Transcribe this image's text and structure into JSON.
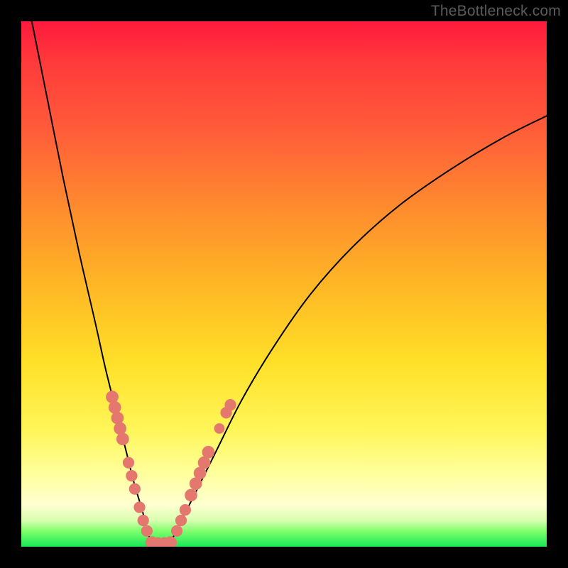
{
  "watermark": "TheBottleneck.com",
  "chart_data": {
    "type": "line",
    "title": "",
    "xlabel": "",
    "ylabel": "",
    "xlim": [
      0,
      100
    ],
    "ylim": [
      0,
      100
    ],
    "grid": false,
    "legend": false,
    "background_gradient": [
      "#ff1a3c",
      "#ff8a2e",
      "#ffe028",
      "#ffff9c",
      "#18e858"
    ],
    "series": [
      {
        "name": "left-branch",
        "x": [
          2,
          5,
          8,
          11,
          14,
          16,
          18,
          20,
          21.5,
          23,
          24,
          25
        ],
        "y": [
          100,
          85,
          70,
          56,
          43,
          34,
          26,
          18,
          12,
          7,
          3,
          0
        ]
      },
      {
        "name": "right-branch",
        "x": [
          28,
          30,
          33,
          37,
          42,
          48,
          55,
          63,
          72,
          82,
          92,
          100
        ],
        "y": [
          0,
          4,
          10,
          18,
          28,
          38,
          48,
          57,
          65,
          72,
          78,
          82
        ]
      }
    ],
    "marker_clusters": [
      {
        "name": "left-cluster-upper",
        "color": "#e4786f",
        "points": [
          {
            "x": 17.3,
            "y": 28.5,
            "r": 1.2
          },
          {
            "x": 17.8,
            "y": 26.5,
            "r": 1.2
          },
          {
            "x": 18.3,
            "y": 24.5,
            "r": 1.2
          },
          {
            "x": 18.8,
            "y": 22.5,
            "r": 1.2
          },
          {
            "x": 19.3,
            "y": 20.5,
            "r": 1.2
          }
        ]
      },
      {
        "name": "left-cluster-mid",
        "color": "#e4786f",
        "points": [
          {
            "x": 20.4,
            "y": 16.0,
            "r": 1.1
          },
          {
            "x": 21.0,
            "y": 13.5,
            "r": 1.1
          },
          {
            "x": 21.6,
            "y": 11.0,
            "r": 1.1
          }
        ]
      },
      {
        "name": "left-cluster-lower",
        "color": "#e4786f",
        "points": [
          {
            "x": 22.5,
            "y": 7.5,
            "r": 1.1
          },
          {
            "x": 23.2,
            "y": 5.0,
            "r": 1.1
          },
          {
            "x": 23.9,
            "y": 3.0,
            "r": 1.1
          }
        ]
      },
      {
        "name": "bottom-cluster",
        "color": "#e4786f",
        "points": [
          {
            "x": 24.8,
            "y": 0.8,
            "r": 1.2
          },
          {
            "x": 26.0,
            "y": 0.6,
            "r": 1.2
          },
          {
            "x": 27.2,
            "y": 0.6,
            "r": 1.2
          },
          {
            "x": 28.4,
            "y": 0.8,
            "r": 1.2
          }
        ]
      },
      {
        "name": "right-cluster-lower",
        "color": "#e4786f",
        "points": [
          {
            "x": 29.6,
            "y": 3.0,
            "r": 1.1
          },
          {
            "x": 30.4,
            "y": 5.0,
            "r": 1.1
          },
          {
            "x": 31.2,
            "y": 7.0,
            "r": 1.1
          }
        ]
      },
      {
        "name": "right-cluster-mid",
        "color": "#e4786f",
        "points": [
          {
            "x": 32.3,
            "y": 9.8,
            "r": 1.2
          },
          {
            "x": 33.2,
            "y": 12.0,
            "r": 1.2
          },
          {
            "x": 34.0,
            "y": 14.0,
            "r": 1.2
          },
          {
            "x": 34.8,
            "y": 16.0,
            "r": 1.2
          },
          {
            "x": 35.6,
            "y": 18.0,
            "r": 1.2
          }
        ]
      },
      {
        "name": "right-cluster-gap-dot",
        "color": "#e4786f",
        "points": [
          {
            "x": 37.7,
            "y": 22.5,
            "r": 1.0
          }
        ]
      },
      {
        "name": "right-cluster-upper",
        "color": "#e4786f",
        "points": [
          {
            "x": 39.0,
            "y": 25.5,
            "r": 1.1
          },
          {
            "x": 39.8,
            "y": 27.0,
            "r": 1.1
          }
        ]
      }
    ]
  }
}
